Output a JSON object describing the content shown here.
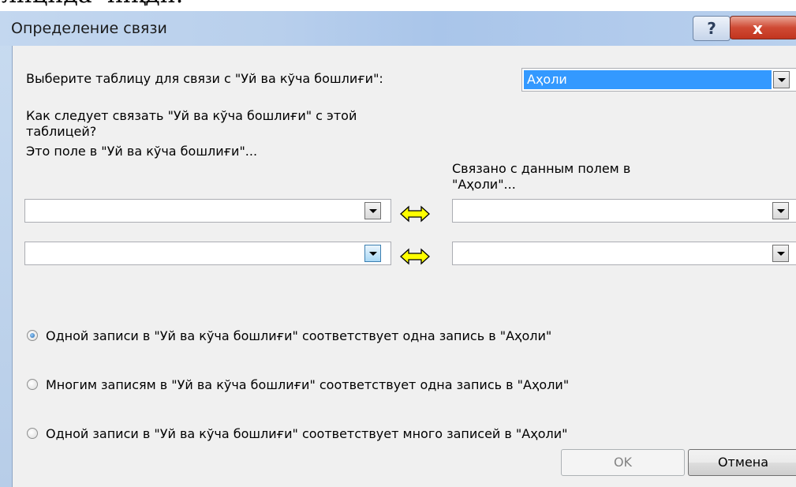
{
  "top_caption": "лицида чиқди.",
  "window": {
    "title": "Определение связи",
    "help_label": "?",
    "close_label": "x"
  },
  "dialog": {
    "select_table_label": "Выберите таблицу для связи с \"Уй ва кўча бошлиғи\":",
    "selected_table": "Аҳоли",
    "how_link_line1": "Как следует связать \"Уй ва кўча бошлиғи\" с этой",
    "how_link_line2": "таблицей?",
    "left_field_header": "Это поле в \"Уй ва кўча бошлиғи\"...",
    "right_field_header_line1": "Связано с данным полем в",
    "right_field_header_line2": "\"Аҳоли\"...",
    "field_rows": [
      {
        "left_value": "",
        "right_value": ""
      },
      {
        "left_value": "",
        "right_value": ""
      }
    ],
    "radio_options": [
      {
        "label": "Одной записи в \"Уй ва кўча бошлиғи\" соответствует одна запись в \"Аҳоли\"",
        "checked": true
      },
      {
        "label": "Многим записям в \"Уй ва кўча бошлиғи\" соответствует одна запись в \"Аҳоли\"",
        "checked": false
      },
      {
        "label": "Одной записи в \"Уй ва кўча бошлиғи\" соответствует много записей в \"Аҳоли\"",
        "checked": false
      }
    ],
    "ok_label": "OK",
    "cancel_label": "Отмена"
  },
  "colors": {
    "selection": "#3399ff",
    "arrow_fill": "#ffff00",
    "close_button": "#c2351f"
  },
  "icons": [
    "help-icon",
    "close-icon",
    "dropdown-arrow-icon",
    "bidirectional-arrow-icon",
    "radio-icon"
  ]
}
